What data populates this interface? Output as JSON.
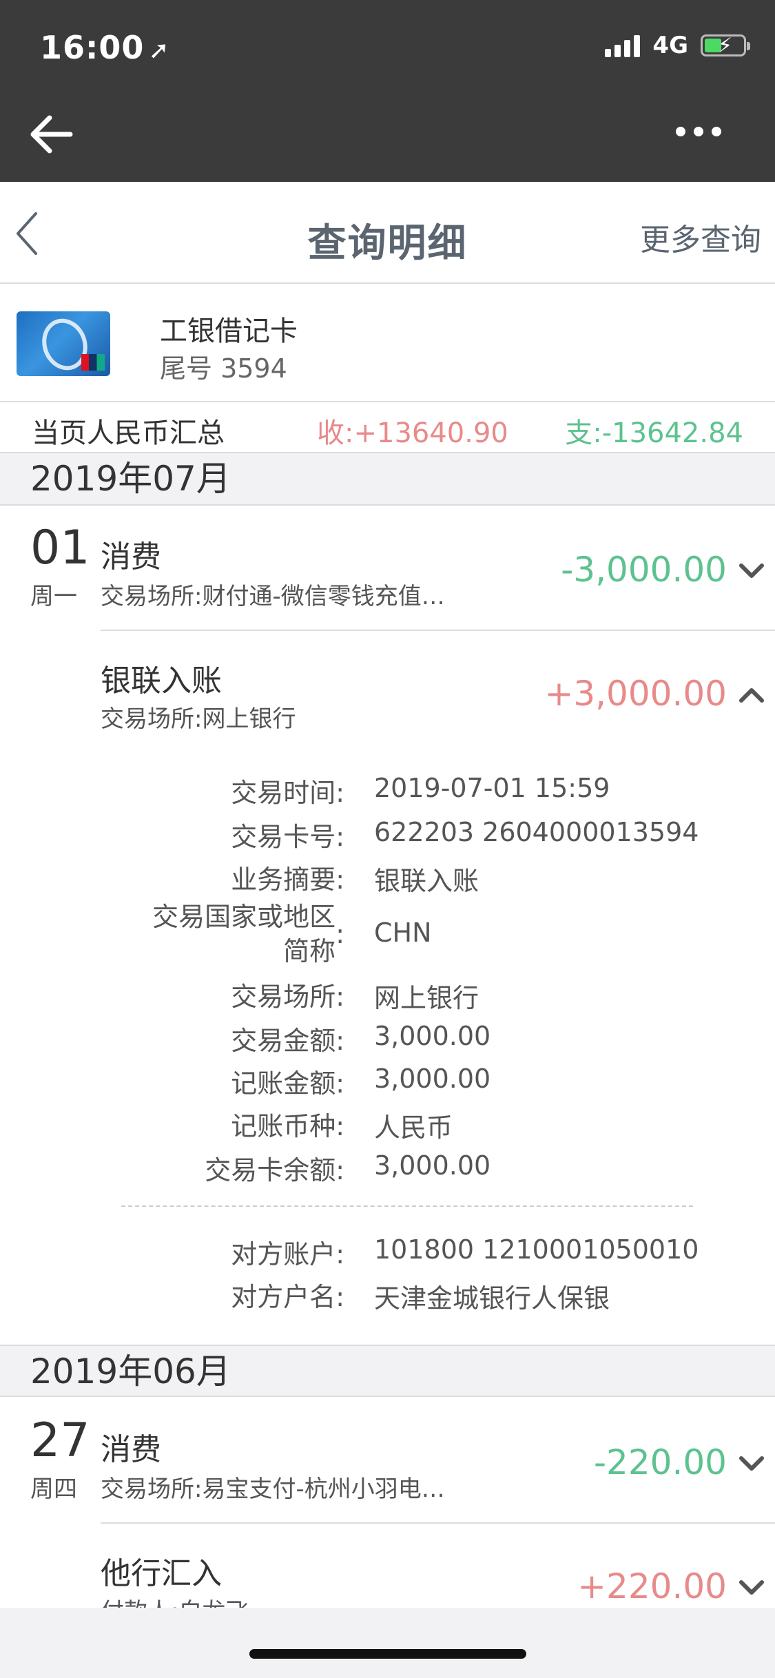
{
  "status_bar": {
    "time": "16:00",
    "network": "4G"
  },
  "header": {
    "title": "查询明细",
    "more_label": "更多查询"
  },
  "card": {
    "name": "工银借记卡",
    "tail": "尾号 3594"
  },
  "summary": {
    "label": "当页人民币汇总",
    "income": "收:+13640.90",
    "expense": "支:-13642.84"
  },
  "months": [
    "2019年07月",
    "2019年06月"
  ],
  "tx1": {
    "day": "01",
    "weekday": "周一",
    "type": "消费",
    "place": "交易场所:财付通-微信零钱充值…",
    "amount": "-3,000.00"
  },
  "tx2": {
    "type": "银联入账",
    "place": "交易场所:网上银行",
    "amount": "+3,000.00"
  },
  "details": [
    {
      "label": "交易时间:",
      "value": "2019-07-01 15:59"
    },
    {
      "label": "交易卡号:",
      "value": "622203 2604000013594"
    },
    {
      "label": "业务摘要:",
      "value": "银联入账"
    },
    {
      "label": "交易国家或地区简称:",
      "label_line1": "交易国家或地区",
      "label_line2": "简称",
      "value": "CHN"
    },
    {
      "label": "交易场所:",
      "value": "网上银行"
    },
    {
      "label": "交易金额:",
      "value": "3,000.00"
    },
    {
      "label": "记账金额:",
      "value": "3,000.00"
    },
    {
      "label": "记账币种:",
      "value": "人民币"
    },
    {
      "label": "交易卡余额:",
      "value": "3,000.00"
    }
  ],
  "counterparty": [
    {
      "label": "对方账户:",
      "value": "101800 1210001050010"
    },
    {
      "label": "对方户名:",
      "value": "天津金城银行人保银"
    }
  ],
  "tx3": {
    "day": "27",
    "weekday": "周四",
    "type": "消费",
    "place": "交易场所:易宝支付-杭州小羽电…",
    "amount": "-220.00"
  },
  "tx4": {
    "type": "他行汇入",
    "place": "付款人:白龙飞",
    "amount": "+220.00"
  },
  "colors": {
    "expense": "#5cc28f",
    "income": "#e88a8a",
    "topbar": "#3b3b3b"
  }
}
